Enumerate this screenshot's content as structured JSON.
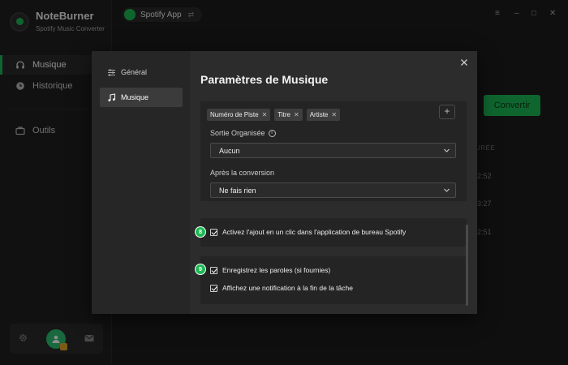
{
  "app": {
    "name": "NoteBurner",
    "subtitle": "Spotify Music Converter",
    "source_label": "Spotify App"
  },
  "sidebar": {
    "items": [
      {
        "label": "Musique",
        "icon": "headphones-icon",
        "active": true
      },
      {
        "label": "Historique",
        "icon": "clock-icon",
        "active": false
      },
      {
        "label": "Outils",
        "icon": "toolbox-icon",
        "active": false
      }
    ],
    "bottom": {
      "settings_icon": "gear-icon",
      "avatar_icon": "user-avatar-icon",
      "mail_icon": "mail-icon"
    }
  },
  "main": {
    "convert_label": "Convertir",
    "duration_header": "URÉE",
    "durations": [
      "2:52",
      "3:27",
      "2:51"
    ]
  },
  "dialog": {
    "tabs": [
      {
        "label": "Général",
        "icon": "sliders-icon",
        "active": false
      },
      {
        "label": "Musique",
        "icon": "music-note-icon",
        "active": true
      }
    ],
    "title": "Paramètres de Musique",
    "filename_tags": [
      "Numéro de Piste",
      "Titre",
      "Artiste"
    ],
    "add_tag_label": "+",
    "output_label": "Sortie Organisée",
    "output_value": "Aucun",
    "after_label": "Après la conversion",
    "after_value": "Ne fais rien",
    "step8": "8",
    "step9": "9",
    "checks": [
      {
        "label": "Activez l'ajout en un clic dans l'application de bureau Spotify",
        "checked": true
      },
      {
        "label": "Enregistrez les paroles (si fournies)",
        "checked": true
      },
      {
        "label": "Affichez une notification à la fin de la tâche",
        "checked": true
      }
    ]
  },
  "colors": {
    "accent": "#1db954",
    "background": "#1e1e1e",
    "dialog": "#2c2c2c"
  }
}
